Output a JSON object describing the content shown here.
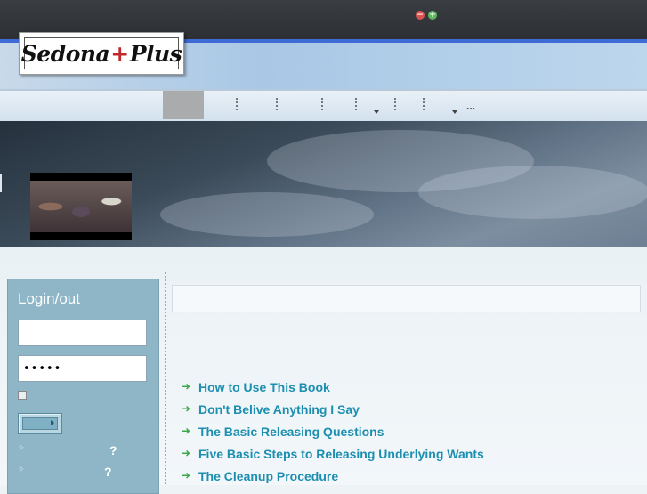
{
  "toolbar": {
    "zoom_out": "−",
    "zoom_in": "+"
  },
  "logo": {
    "word1": "Sedona",
    "plus": "+",
    "word2": "Plus"
  },
  "nav": {
    "more": "..."
  },
  "login": {
    "title": "Login/out",
    "username_value": "",
    "password_value": "•••••",
    "help1": "?",
    "help2": "?"
  },
  "toc": {
    "items": [
      {
        "label": "How to Use This Book"
      },
      {
        "label": "Don't Belive Anything I Say"
      },
      {
        "label": "The Basic Releasing Questions"
      },
      {
        "label": "Five Basic Steps to Releasing Underlying Wants"
      },
      {
        "label": "The Cleanup Procedure"
      }
    ]
  },
  "icons": {
    "toc_arrow": "arrow-right-icon"
  },
  "colors": {
    "accent_blue": "#3f6bd6",
    "link": "#1c8fb0",
    "login_panel": "#8eb6c6"
  }
}
